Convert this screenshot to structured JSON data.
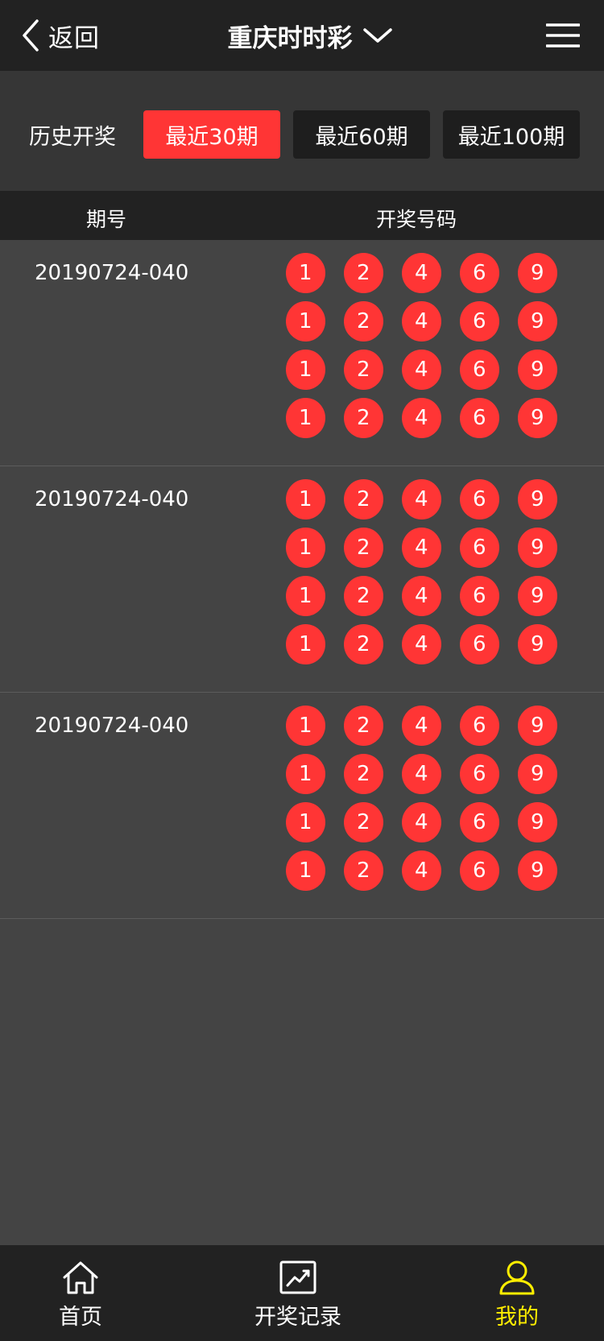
{
  "header": {
    "back_label": "返回",
    "title": "重庆时时彩"
  },
  "filter": {
    "label": "历史开奖",
    "buttons": [
      "最近30期",
      "最近60期",
      "最近100期"
    ],
    "active_index": 0
  },
  "table": {
    "columns": [
      "期号",
      "开奖号码"
    ]
  },
  "records": [
    {
      "period": "20190724-040",
      "numbers": [
        [
          "1",
          "2",
          "4",
          "6",
          "9"
        ],
        [
          "1",
          "2",
          "4",
          "6",
          "9"
        ],
        [
          "1",
          "2",
          "4",
          "6",
          "9"
        ],
        [
          "1",
          "2",
          "4",
          "6",
          "9"
        ]
      ]
    },
    {
      "period": "20190724-040",
      "numbers": [
        [
          "1",
          "2",
          "4",
          "6",
          "9"
        ],
        [
          "1",
          "2",
          "4",
          "6",
          "9"
        ],
        [
          "1",
          "2",
          "4",
          "6",
          "9"
        ],
        [
          "1",
          "2",
          "4",
          "6",
          "9"
        ]
      ]
    },
    {
      "period": "20190724-040",
      "numbers": [
        [
          "1",
          "2",
          "4",
          "6",
          "9"
        ],
        [
          "1",
          "2",
          "4",
          "6",
          "9"
        ],
        [
          "1",
          "2",
          "4",
          "6",
          "9"
        ],
        [
          "1",
          "2",
          "4",
          "6",
          "9"
        ]
      ]
    }
  ],
  "tabbar": {
    "items": [
      {
        "label": "首页",
        "icon": "home-icon"
      },
      {
        "label": "开奖记录",
        "icon": "chart-icon"
      },
      {
        "label": "我的",
        "icon": "user-icon"
      }
    ],
    "active_index": 2
  },
  "colors": {
    "accent": "#ff3535",
    "active_tab": "#ffee00",
    "background": "#444444",
    "bar": "#222222"
  }
}
